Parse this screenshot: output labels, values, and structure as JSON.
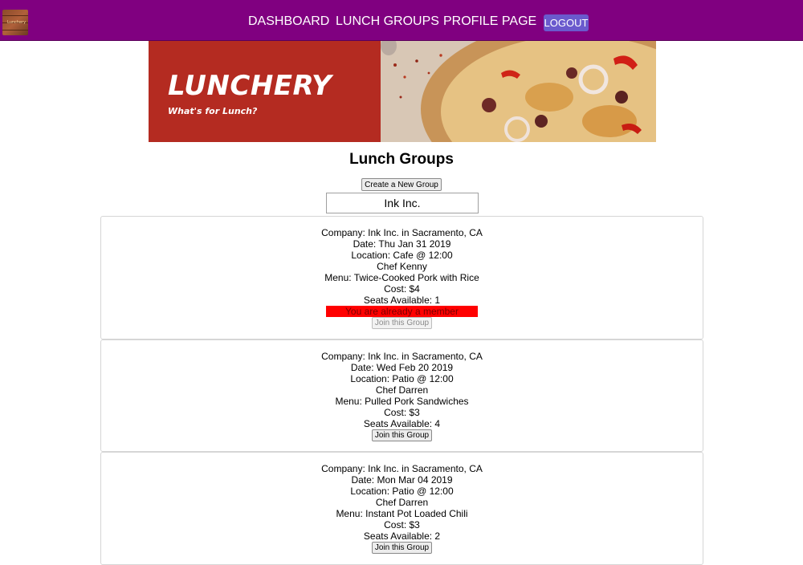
{
  "nav": {
    "logo_text": "Lunchery",
    "links": [
      "DASHBOARD",
      "LUNCH GROUPS",
      "PROFILE PAGE"
    ],
    "logout_label": "LOGOUT"
  },
  "hero": {
    "title": "LUNCHERY",
    "subtitle": "What's for Lunch?"
  },
  "page": {
    "title": "Lunch Groups",
    "create_button": "Create a New Group",
    "company_filter": "Ink Inc."
  },
  "groups": [
    {
      "company": "Company: Ink Inc. in Sacramento, CA",
      "date": "Date: Thu Jan 31 2019",
      "location": "Location: Cafe @ 12:00",
      "chef": "Chef Kenny",
      "menu": "Menu: Twice-Cooked Pork with Rice",
      "cost": "Cost: $4",
      "seats": "Seats Available: 1",
      "member_notice": "You are already a member",
      "join_label": "Join this Group"
    },
    {
      "company": "Company: Ink Inc. in Sacramento, CA",
      "date": "Date: Wed Feb 20 2019",
      "location": "Location: Patio @ 12:00",
      "chef": "Chef Darren",
      "menu": "Menu: Pulled Pork Sandwiches",
      "cost": "Cost: $3",
      "seats": "Seats Available: 4",
      "join_label": "Join this Group"
    },
    {
      "company": "Company: Ink Inc. in Sacramento, CA",
      "date": "Date: Mon Mar 04 2019",
      "location": "Location: Patio @ 12:00",
      "chef": "Chef Darren",
      "menu": "Menu: Instant Pot Loaded Chili",
      "cost": "Cost: $3",
      "seats": "Seats Available: 2",
      "join_label": "Join this Group"
    }
  ],
  "colors": {
    "navbar": "#800080",
    "logout_button": "#6a5acd",
    "hero_red": "#b42b21",
    "member_notice": "#ff0000"
  }
}
